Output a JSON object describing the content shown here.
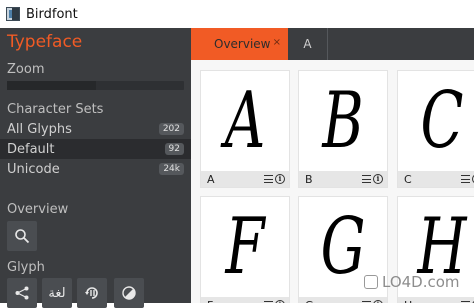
{
  "window": {
    "title": "Birdfont"
  },
  "sidebar": {
    "typeface_label": "Typeface",
    "zoom_label": "Zoom",
    "zoom_level": 0.5,
    "character_sets_label": "Character Sets",
    "character_sets": [
      {
        "label": "All Glyphs",
        "count": "202",
        "selected": false
      },
      {
        "label": "Default",
        "count": "92",
        "selected": true
      },
      {
        "label": "Unicode",
        "count": "24k",
        "selected": false
      }
    ],
    "overview_label": "Overview",
    "overview_tool_icon": "search-icon",
    "glyph_label": "Glyph",
    "glyph_tools": [
      {
        "icon": "share-icon"
      },
      {
        "icon": "arabic-text-icon",
        "text": "لغة"
      },
      {
        "icon": "rotate-icon"
      },
      {
        "icon": "half-circle-icon"
      }
    ]
  },
  "tabs": [
    {
      "label": "Overview",
      "active": true,
      "close_label": "×"
    },
    {
      "label": "A",
      "active": false
    }
  ],
  "overview": {
    "glyphs": [
      {
        "char": "A",
        "label": "A"
      },
      {
        "char": "B",
        "label": "B"
      },
      {
        "char": "C",
        "label": "C"
      },
      {
        "char": "F",
        "label": "F"
      },
      {
        "char": "G",
        "label": "G"
      },
      {
        "char": "H",
        "label": "H"
      }
    ]
  },
  "watermark": {
    "text": "LO4D.com"
  },
  "colors": {
    "accent": "#f15b25",
    "sidebar_bg": "#3b3d40",
    "overview_bg": "#f7f7f7"
  }
}
